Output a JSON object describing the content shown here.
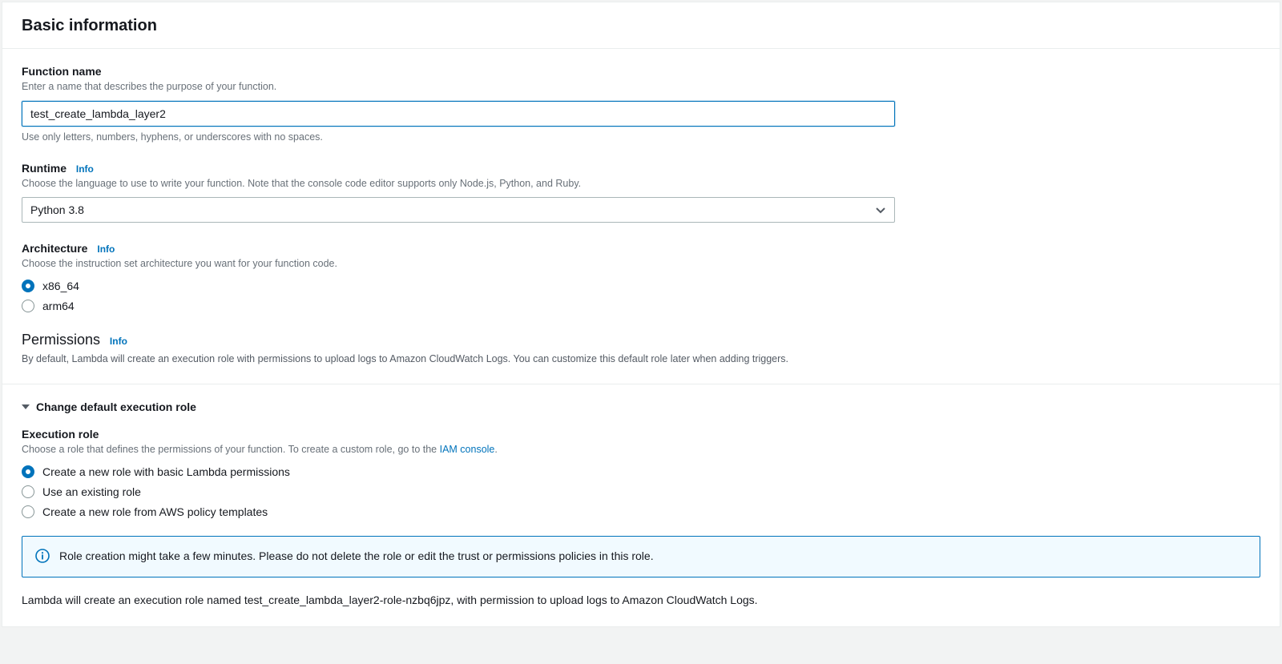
{
  "header": {
    "title": "Basic information"
  },
  "functionName": {
    "label": "Function name",
    "help": "Enter a name that describes the purpose of your function.",
    "value": "test_create_lambda_layer2",
    "hint": "Use only letters, numbers, hyphens, or underscores with no spaces."
  },
  "runtime": {
    "label": "Runtime",
    "infoLabel": "Info",
    "help": "Choose the language to use to write your function. Note that the console code editor supports only Node.js, Python, and Ruby.",
    "value": "Python 3.8"
  },
  "architecture": {
    "label": "Architecture",
    "infoLabel": "Info",
    "help": "Choose the instruction set architecture you want for your function code.",
    "options": [
      {
        "label": "x86_64",
        "checked": true
      },
      {
        "label": "arm64",
        "checked": false
      }
    ]
  },
  "permissions": {
    "heading": "Permissions",
    "infoLabel": "Info",
    "desc": "By default, Lambda will create an execution role with permissions to upload logs to Amazon CloudWatch Logs. You can customize this default role later when adding triggers."
  },
  "executionRole": {
    "expandTitle": "Change default execution role",
    "label": "Execution role",
    "helpPrefix": "Choose a role that defines the permissions of your function. To create a custom role, go to the ",
    "iamLink": "IAM console",
    "helpSuffix": ".",
    "options": [
      {
        "label": "Create a new role with basic Lambda permissions",
        "checked": true
      },
      {
        "label": "Use an existing role",
        "checked": false
      },
      {
        "label": "Create a new role from AWS policy templates",
        "checked": false
      }
    ],
    "alert": "Role creation might take a few minutes. Please do not delete the role or edit the trust or permissions policies in this role.",
    "roleText": "Lambda will create an execution role named test_create_lambda_layer2-role-nzbq6jpz, with permission to upload logs to Amazon CloudWatch Logs."
  }
}
